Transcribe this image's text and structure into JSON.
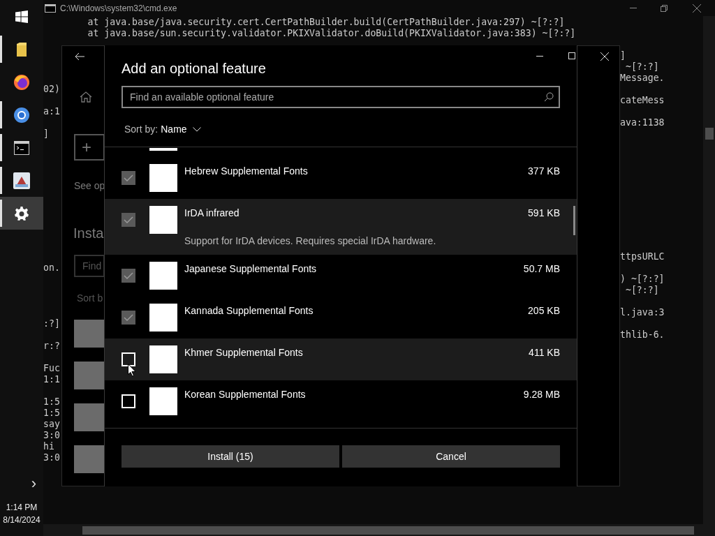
{
  "taskbar": {
    "apps": [
      {
        "kind": "start",
        "running": false,
        "selected": false
      },
      {
        "kind": "files",
        "running": true,
        "selected": false
      },
      {
        "kind": "firefox",
        "running": false,
        "selected": false
      },
      {
        "kind": "chrome",
        "running": true,
        "selected": false
      },
      {
        "kind": "terminal",
        "running": true,
        "selected": false
      },
      {
        "kind": "image",
        "running": true,
        "selected": false
      },
      {
        "kind": "settings",
        "running": true,
        "selected": true
      }
    ],
    "overflow": "›",
    "time": "1:14 PM",
    "date": "8/14/2024"
  },
  "console": {
    "title": "C:\\Windows\\system32\\cmd.exe",
    "lines": [
      {
        "full": "        at java.base/java.security.cert.CertPathBuilder.build(CertPathBuilder.java:297) ~[?:?]"
      },
      {
        "full": "        at java.base/sun.security.validator.PKIXValidator.doBuild(PKIXValidator.java:383) ~[?:?]"
      },
      {
        "right": "]"
      },
      {
        "right": " ~[?:?]"
      },
      {
        "right": "Message."
      },
      {
        "left": "02)"
      },
      {
        "right": "cateMess"
      },
      {
        "left": "a:1"
      },
      {
        "right": "ava:1138"
      },
      {
        "left": "]"
      },
      {
        "right": "ttpsURLC"
      },
      {
        "left": "on."
      },
      {
        "right": ") ~[?:?]"
      },
      {
        "right": " ~[?:?]"
      },
      {
        "right": "l.java:3"
      },
      {
        "left": ":?]"
      },
      {
        "right": "thlib-6."
      },
      {
        "left": "r:?"
      },
      {
        "left": "Fuc"
      },
      {
        "left": "1:1"
      },
      {
        "left": "1:5"
      },
      {
        "left": "1:5"
      },
      {
        "left": "say"
      },
      {
        "left": "3:0"
      },
      {
        "left": "hi"
      },
      {
        "left": "3:0"
      }
    ]
  },
  "settings": {
    "add_label": "+",
    "link": "See op",
    "heading": "Insta",
    "search_placeholder": "Find",
    "sort": "Sort b"
  },
  "dialog": {
    "title": "Add an optional feature",
    "search": {
      "placeholder": "Find an available optional feature"
    },
    "sort": {
      "label": "Sort by:",
      "value": "Name"
    },
    "features": [
      {
        "name": "Hebrew Supplemental Fonts",
        "size": "377 KB",
        "checked": true,
        "highlighted": false
      },
      {
        "name": "IrDA infrared",
        "size": "591 KB",
        "checked": true,
        "highlighted": true,
        "description": "Support for IrDA devices. Requires special IrDA hardware."
      },
      {
        "name": "Japanese Supplemental Fonts",
        "size": "50.7 MB",
        "checked": true,
        "highlighted": false
      },
      {
        "name": "Kannada Supplemental Fonts",
        "size": "205 KB",
        "checked": true,
        "highlighted": false
      },
      {
        "name": "Khmer Supplemental Fonts",
        "size": "411 KB",
        "checked": false,
        "highlighted": true
      },
      {
        "name": "Korean Supplemental Fonts",
        "size": "9.28 MB",
        "checked": false,
        "highlighted": false
      }
    ],
    "install": "Install (15)",
    "cancel": "Cancel"
  }
}
